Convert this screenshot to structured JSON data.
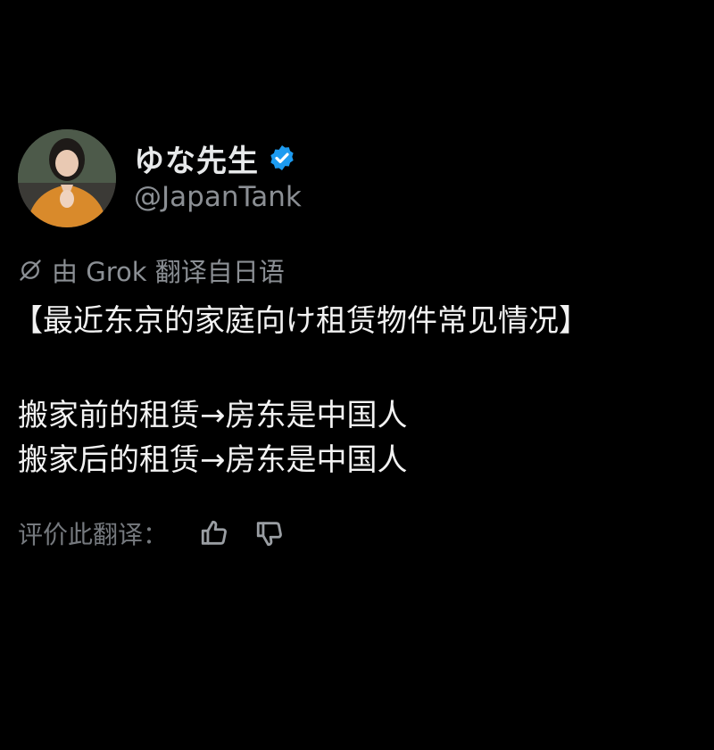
{
  "author": {
    "display_name": "ゆな先生",
    "handle": "@JapanTank",
    "verified": true,
    "avatar": "profile-photo"
  },
  "translation_note": {
    "icon": "grok-icon",
    "text": "由 Grok 翻译自日语"
  },
  "tweet": {
    "lines": [
      "【最近东京的家庭向け租赁物件常见情况】",
      "",
      "搬家前的租赁→房东是中国人",
      "搬家后的租赁→房东是中国人"
    ]
  },
  "rating": {
    "label": "评价此翻译：",
    "thumbs_up_icon": "thumbs-up-icon",
    "thumbs_down_icon": "thumbs-down-icon"
  },
  "colors": {
    "background": "#000000",
    "primary_text": "#e7e9ea",
    "secondary_text": "#8b8f94",
    "verified_blue": "#1d9bf0"
  }
}
